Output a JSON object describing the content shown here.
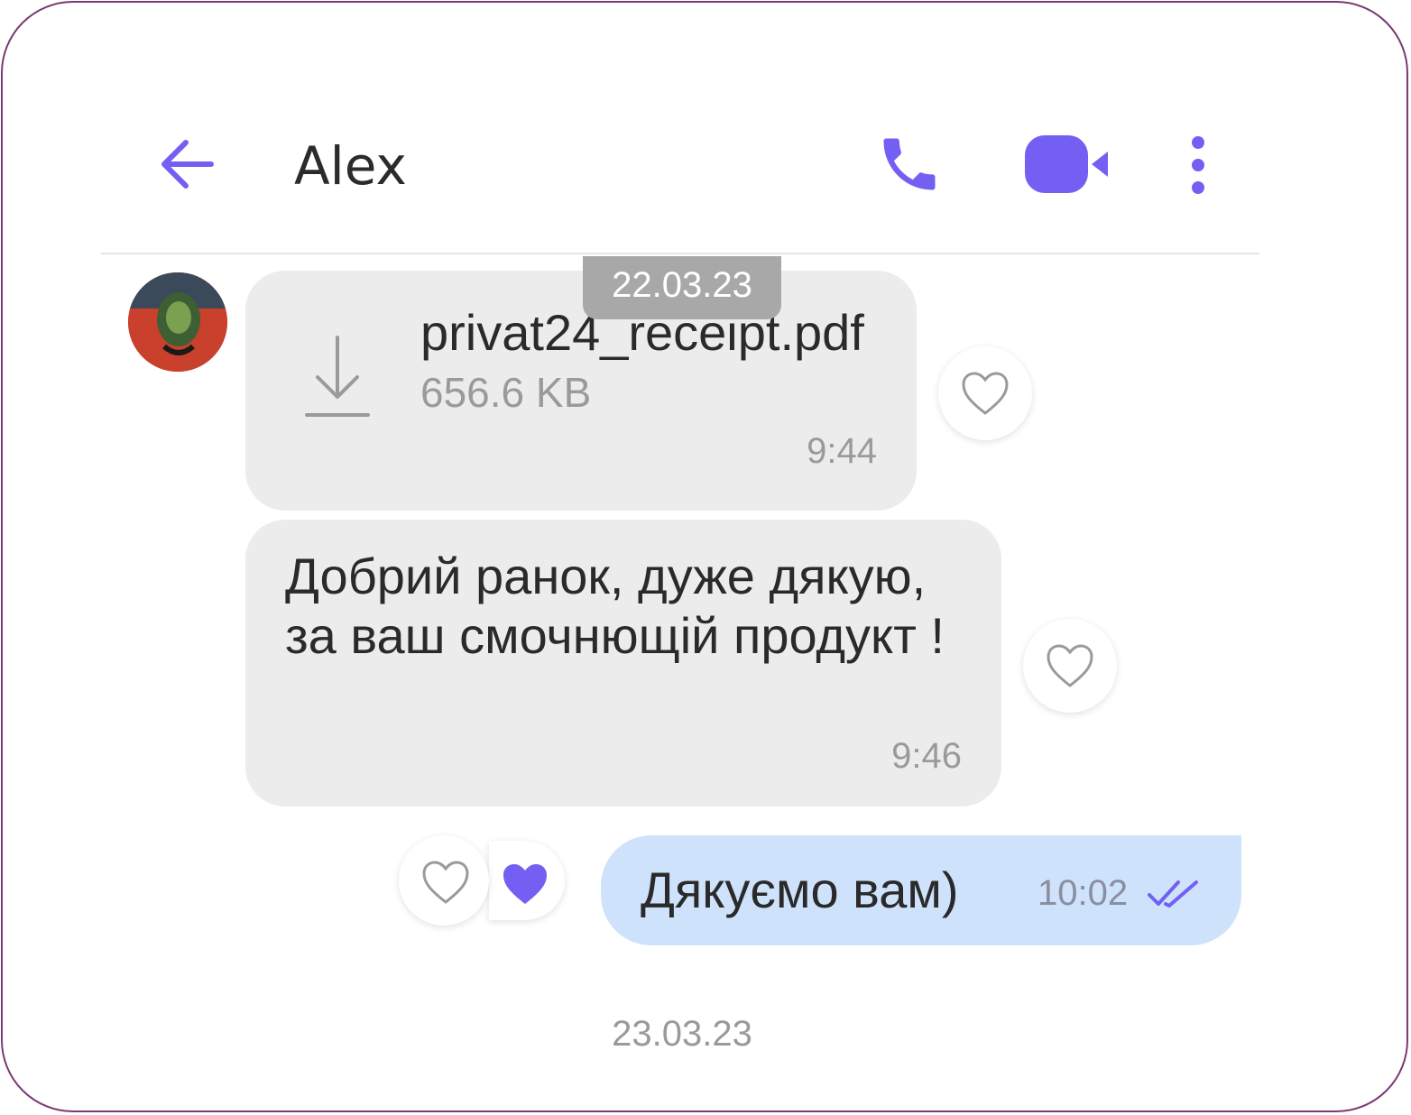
{
  "header": {
    "title": "Alex",
    "back_icon": "arrow-left-icon",
    "call_icon": "phone-icon",
    "video_icon": "video-camera-icon",
    "menu_icon": "more-vertical-icon"
  },
  "date_separator_top": "22.03.23",
  "messages": [
    {
      "type": "file",
      "direction": "incoming",
      "file_name": "privat24_receipt.pdf",
      "file_size": "656.6 KB",
      "time": "9:44",
      "icon": "download-icon"
    },
    {
      "type": "text",
      "direction": "incoming",
      "text": "Добрий ранок, дуже дякую, за ваш смочнющій продукт !",
      "time": "9:46"
    },
    {
      "type": "text",
      "direction": "outgoing",
      "text": "Дякуємо вам)",
      "time": "10:02",
      "status_icon": "double-check-icon"
    }
  ],
  "date_separator_bottom": "23.03.23",
  "colors": {
    "accent": "#7360f2",
    "incoming_bubble": "#ececec",
    "outgoing_bubble": "#cfe2fb",
    "frame_border": "#7a3a72"
  }
}
